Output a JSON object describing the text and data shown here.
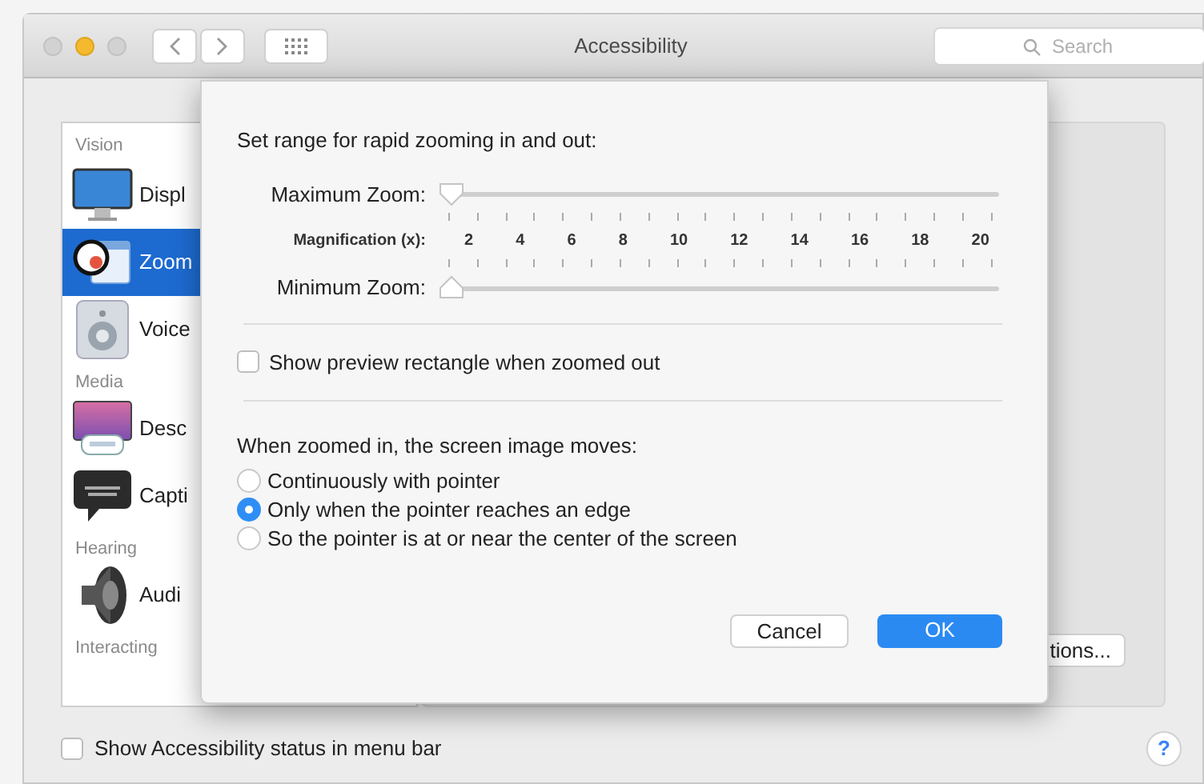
{
  "window": {
    "title": "Accessibility",
    "search": {
      "placeholder": "Search"
    }
  },
  "sidebar": {
    "items": [
      {
        "kind": "header",
        "label": "Vision"
      },
      {
        "kind": "item",
        "label": "Displ",
        "selected": false
      },
      {
        "kind": "item",
        "label": "Zoom",
        "selected": true
      },
      {
        "kind": "item",
        "label": "Voice",
        "selected": false
      },
      {
        "kind": "header",
        "label": "Media"
      },
      {
        "kind": "item",
        "label": "Desc",
        "selected": false
      },
      {
        "kind": "item",
        "label": "Capti",
        "selected": false
      },
      {
        "kind": "header",
        "label": "Hearing"
      },
      {
        "kind": "item",
        "label": "Audi",
        "selected": false
      },
      {
        "kind": "header",
        "label": "Interacting"
      }
    ]
  },
  "options_button": {
    "label": "tions..."
  },
  "status_checkbox": {
    "label": "Show Accessibility status in menu bar",
    "checked": false
  },
  "help_button": {
    "label": "?"
  },
  "sheet": {
    "heading": "Set range for rapid zooming in and out:",
    "max_zoom": {
      "label": "Maximum Zoom:",
      "level": 0
    },
    "magnification": {
      "label": "Magnification (x):",
      "ticks": [
        "2",
        "4",
        "6",
        "8",
        "10",
        "12",
        "14",
        "16",
        "18",
        "20"
      ]
    },
    "min_zoom": {
      "label": "Minimum Zoom:",
      "level": 0
    },
    "preview_checkbox": {
      "label": "Show preview rectangle when zoomed out",
      "checked": false
    },
    "movement": {
      "label": "When zoomed in, the screen image moves:",
      "options": [
        {
          "label": "Continuously with pointer",
          "selected": false
        },
        {
          "label": "Only when the pointer reaches an edge",
          "selected": true
        },
        {
          "label": "So the pointer is at or near the center of the screen",
          "selected": false
        }
      ]
    },
    "buttons": [
      {
        "label": "Cancel",
        "default": false
      },
      {
        "label": "OK",
        "default": true
      }
    ]
  }
}
